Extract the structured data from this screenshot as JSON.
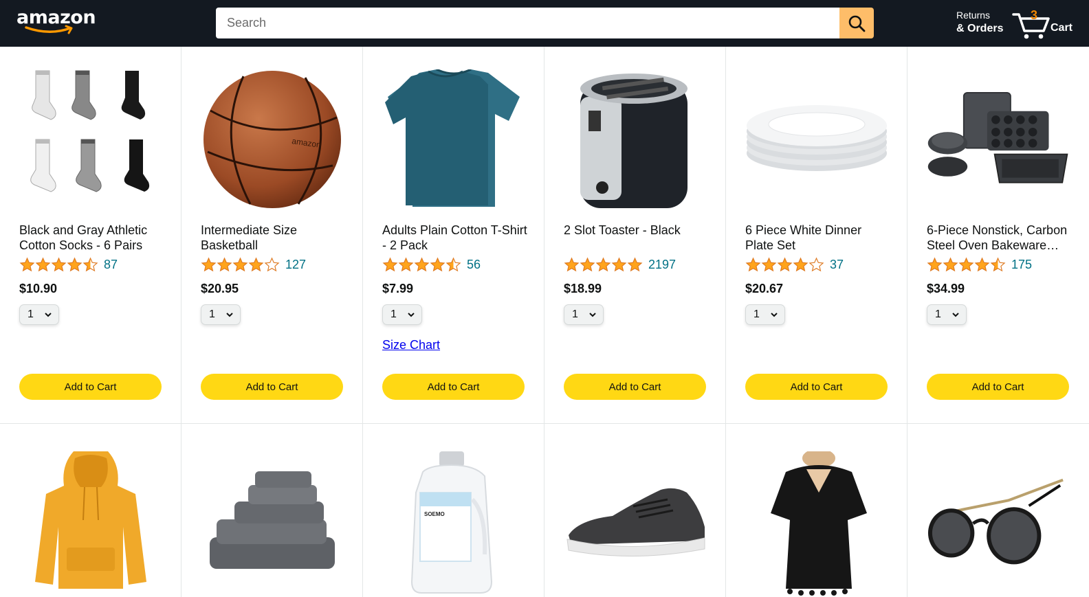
{
  "header": {
    "logo_text": "amazon",
    "search": {
      "placeholder": "Search",
      "value": ""
    },
    "returns_line1": "Returns",
    "returns_line2": "& Orders",
    "cart_count": "3",
    "cart_label": "Cart"
  },
  "colors": {
    "header_bg": "#131921",
    "search_button": "#febd69",
    "add_to_cart": "#ffd814",
    "star": "#ffa41c",
    "rating_link": "#007185",
    "cart_count": "#f08804"
  },
  "products": [
    {
      "title": "Black and Gray Athletic Cotton Socks - 6 Pairs",
      "rating": 4.5,
      "reviews": "87",
      "price": "$10.90",
      "qty": "1",
      "button": "Add to Cart",
      "image": "socks"
    },
    {
      "title": "Intermediate Size Basketball",
      "rating": 4,
      "reviews": "127",
      "price": "$20.95",
      "qty": "1",
      "button": "Add to Cart",
      "image": "basketball"
    },
    {
      "title": "Adults Plain Cotton T-Shirt - 2 Pack",
      "rating": 4.5,
      "reviews": "56",
      "price": "$7.99",
      "qty": "1",
      "button": "Add to Cart",
      "size_chart": "Size Chart",
      "image": "tshirt"
    },
    {
      "title": "2 Slot Toaster - Black",
      "rating": 5,
      "reviews": "2197",
      "price": "$18.99",
      "qty": "1",
      "button": "Add to Cart",
      "image": "toaster"
    },
    {
      "title": "6 Piece White Dinner Plate Set",
      "rating": 4,
      "reviews": "37",
      "price": "$20.67",
      "qty": "1",
      "button": "Add to Cart",
      "image": "plates"
    },
    {
      "title": "6-Piece Nonstick, Carbon Steel Oven Bakeware…",
      "rating": 4.5,
      "reviews": "175",
      "price": "$34.99",
      "qty": "1",
      "button": "Add to Cart",
      "image": "bakeware"
    }
  ],
  "products_row2": [
    {
      "image": "hoodie"
    },
    {
      "image": "towels"
    },
    {
      "image": "detergent",
      "label": "SOEMO"
    },
    {
      "image": "sneaker"
    },
    {
      "image": "beach-dress"
    },
    {
      "image": "sunglasses"
    }
  ]
}
